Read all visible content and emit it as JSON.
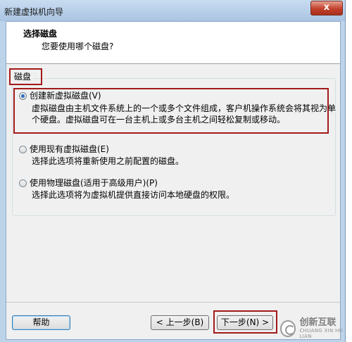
{
  "window": {
    "title": "新建虚拟机向导",
    "close_label": "x"
  },
  "header": {
    "title": "选择磁盘",
    "subtitle": "您要使用哪个磁盘?"
  },
  "group": {
    "label": "磁盘"
  },
  "options": [
    {
      "label": "创建新虚拟磁盘(V)",
      "desc_line1": "虚拟磁盘由主机文件系统上的一个或多个文件组成，客户机操作系统会将其视为单",
      "desc_line2": "个硬盘。虚拟磁盘可在一台主机上或多台主机之间轻松复制或移动。",
      "selected": true
    },
    {
      "label": "使用现有虚拟磁盘(E)",
      "desc_line1": "选择此选项将重新使用之前配置的磁盘。",
      "selected": false
    },
    {
      "label": "使用物理磁盘(适用于高级用户)(P)",
      "desc_line1": "选择此选项将为虚拟机提供直接访问本地硬盘的权限。",
      "selected": false
    }
  ],
  "footer": {
    "help_label": "帮助",
    "back_label": "< 上一步(B)",
    "next_label": "下一步(N) >"
  },
  "watermark": {
    "name": "创新互联",
    "sub": "CHUANG XIN HU LIAN"
  },
  "colors": {
    "highlight": "#a31a1a",
    "titlebar": "#bcd3ea",
    "close_button": "#c2402b"
  }
}
